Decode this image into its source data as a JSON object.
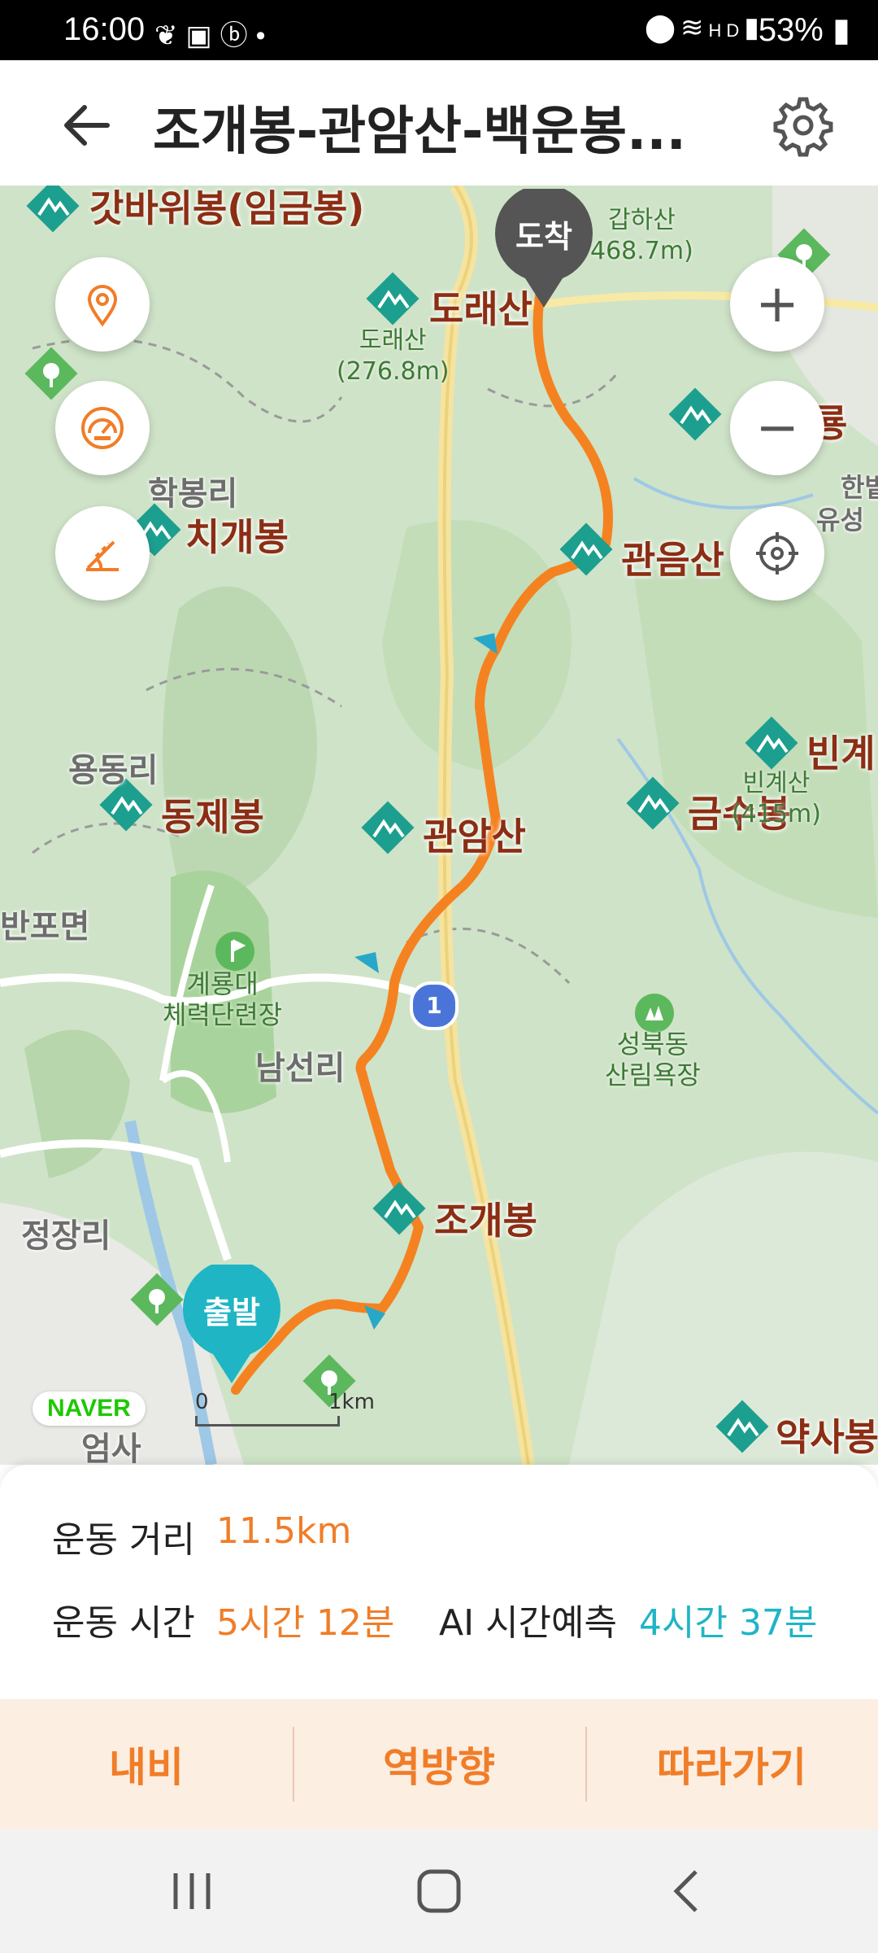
{
  "status_bar": {
    "time": "16:00",
    "left_icons": [
      "leaf-icon",
      "shopping-bag-icon",
      "b-app-icon",
      "dot-icon"
    ],
    "right_icons": [
      "location-icon",
      "wifi-icon",
      "hd-voice-icon",
      "signal-icon"
    ],
    "battery": "53%"
  },
  "header": {
    "title": "조개봉-관암산-백운봉...",
    "back_icon": "arrow-left-icon",
    "settings_icon": "gear-icon"
  },
  "map": {
    "peaks": [
      {
        "name": "갓바위봉(임금봉)"
      },
      {
        "name": "도래산"
      },
      {
        "name": "치개봉"
      },
      {
        "name": "관음산"
      },
      {
        "name": "동제봉"
      },
      {
        "name": "관암산"
      },
      {
        "name": "금수봉"
      },
      {
        "name": "조개봉"
      },
      {
        "name": "빈계"
      },
      {
        "name": "약사봉"
      },
      {
        "name": "룡"
      }
    ],
    "places": [
      "학봉리",
      "용동리",
      "반포면",
      "남선리",
      "정장리",
      "엄사",
      "한밭",
      "유성"
    ],
    "elevations": [
      "도래산\n(276.8m)",
      "갑하산\n468.7m)",
      "빈계산\n(415m)"
    ],
    "facilities": [
      "계룡대\n체력단련장",
      "성북동\n산림욕장"
    ],
    "road_badge": "1",
    "start_pin": "출발",
    "end_pin": "도착",
    "scale_zero": "0",
    "scale_unit": "1km",
    "logo": "NAVER",
    "controls": {
      "location_icon": "location-pin-icon",
      "speed_icon": "speedometer-icon",
      "slope_icon": "slope-icon",
      "zoom_in": "+",
      "zoom_out": "−",
      "gps_icon": "crosshair-icon"
    },
    "colors": {
      "route": "#f58220",
      "peak_marker": "#1d9f8f",
      "pin_start": "#1fb5c4",
      "pin_end": "#555555"
    }
  },
  "info": {
    "distance_label": "운동 거리",
    "distance_value": "11.5km",
    "time_label": "운동 시간",
    "time_value": "5시간 12분",
    "ai_label": "AI 시간예측",
    "ai_value": "4시간 37분"
  },
  "actions": {
    "navi": "내비",
    "reverse": "역방향",
    "follow": "따라가기"
  },
  "nav_bar": [
    "recent-apps-icon",
    "home-icon",
    "back-icon"
  ]
}
